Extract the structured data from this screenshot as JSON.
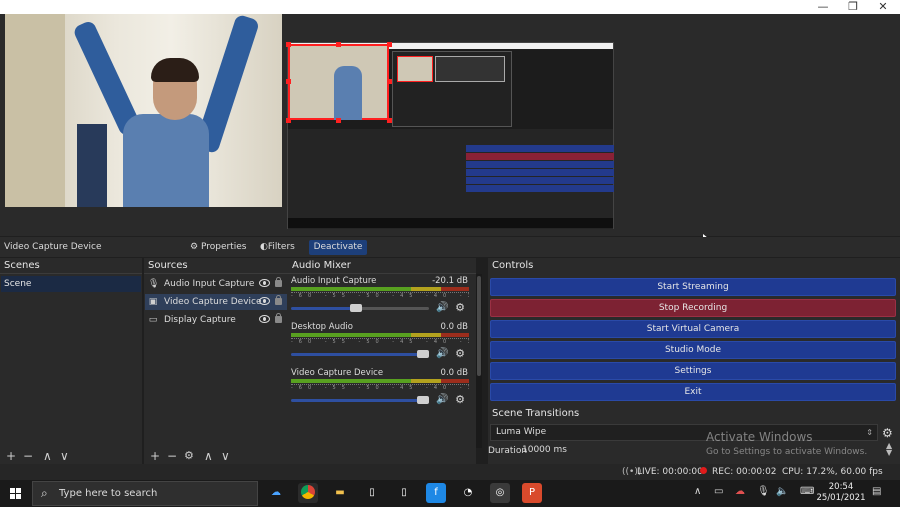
{
  "window": {
    "title_controls": [
      "—",
      "❐",
      "✕"
    ]
  },
  "context_bar": {
    "selected_source": "Video Capture Device",
    "properties_label": "Properties",
    "filters_label": "Filters",
    "deactivate_label": "Deactivate"
  },
  "scenes": {
    "title": "Scenes",
    "items": [
      {
        "label": "Scene",
        "selected": true
      }
    ],
    "toolbar": [
      "+",
      "−",
      "∧",
      "∨"
    ]
  },
  "sources": {
    "title": "Sources",
    "items": [
      {
        "label": "Audio Input Capture",
        "icon": "microphone-icon",
        "selected": false
      },
      {
        "label": "Video Capture Device",
        "icon": "camera-icon",
        "selected": true
      },
      {
        "label": "Display Capture",
        "icon": "monitor-icon",
        "selected": false
      }
    ],
    "toolbar": [
      "+",
      "−",
      "⚙",
      "∧",
      "∨"
    ]
  },
  "audio_mixer": {
    "title": "Audio Mixer",
    "channels": [
      {
        "name": "Audio Input Capture",
        "level": "-20.1 dB",
        "volume": 0.38
      },
      {
        "name": "Desktop Audio",
        "level": "0.0 dB",
        "volume": 1.0
      },
      {
        "name": "Video Capture Device",
        "level": "0.0 dB",
        "volume": 1.0
      }
    ],
    "ticks": "-60 -55 -50 -45 -40 -35 -30 -25 -20 -15 -10 -5 0"
  },
  "controls": {
    "title": "Controls",
    "buttons": [
      "Start Streaming",
      "Stop Recording",
      "Start Virtual Camera",
      "Studio Mode",
      "Settings",
      "Exit"
    ],
    "recording_color": "#7d2233",
    "button_color": "#1f3a92"
  },
  "scene_transitions": {
    "title": "Scene Transitions",
    "selected": "Luma Wipe",
    "duration_label": "Duration",
    "duration_value": "10000 ms"
  },
  "watermark": {
    "line1": "Activate Windows",
    "line2": "Go to Settings to activate Windows."
  },
  "status": {
    "live": "LIVE: 00:00:00",
    "rec": "REC: 00:00:02",
    "cpu": "CPU: 17.2%, 60.00 fps"
  },
  "taskbar": {
    "search_placeholder": "Type here to search",
    "time": "20:54",
    "date": "25/01/2021"
  }
}
